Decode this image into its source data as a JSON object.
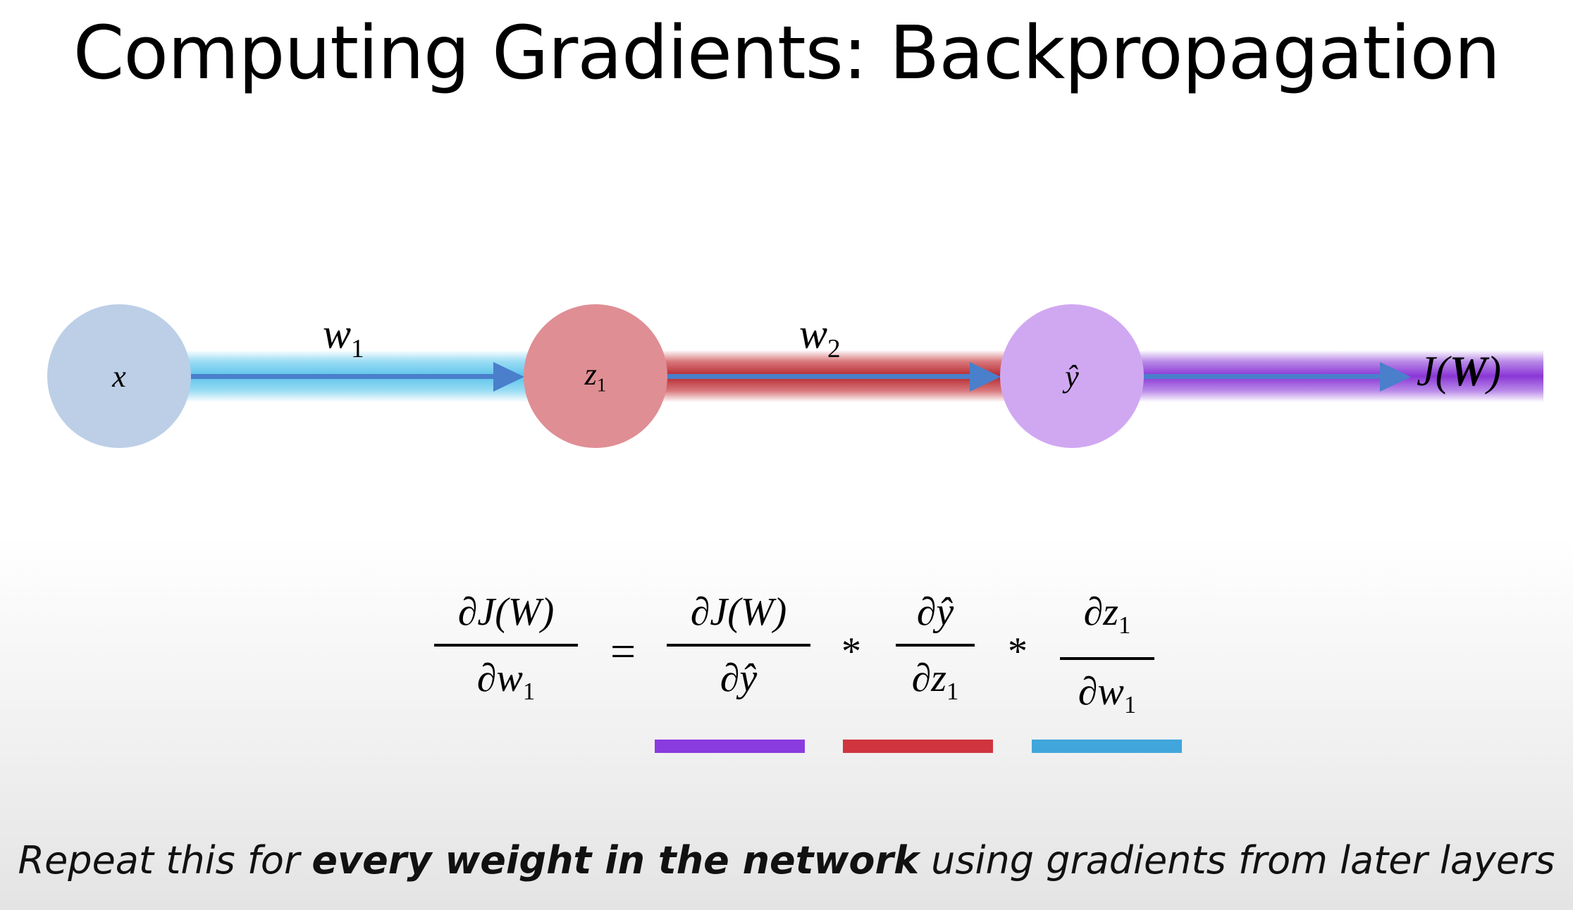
{
  "title": "Computing Gradients: Backpropagation",
  "diagram": {
    "nodes": [
      {
        "id": "x",
        "label": "x",
        "color": "#bccfe7"
      },
      {
        "id": "z1",
        "label": "z",
        "sub": "1",
        "color": "#df8e94"
      },
      {
        "id": "yhat",
        "label": "ŷ",
        "color": "#d0a8f2"
      }
    ],
    "edges": [
      {
        "label": "w",
        "sub": "1",
        "color": "#5cc4ea"
      },
      {
        "label": "w",
        "sub": "2",
        "color": "#b5262d"
      },
      {
        "color": "#8a36d6"
      }
    ],
    "output_label_pre": "J(",
    "output_label_bold": "W",
    "output_label_post": ")",
    "arrow_color": "#4a7fcb"
  },
  "equation": {
    "lhs": {
      "num": "∂J(W)",
      "den_pre": "∂w",
      "den_sub": "1"
    },
    "equals": "=",
    "times": "*",
    "terms": [
      {
        "num": "∂J(W)",
        "den": "∂ŷ",
        "underline_color": "#8a3be0"
      },
      {
        "num": "∂ŷ",
        "den_pre": "∂z",
        "den_sub": "1",
        "underline_color": "#d0343e"
      },
      {
        "num_pre": "∂z",
        "num_sub": "1",
        "den_pre": "∂w",
        "den_sub": "1",
        "underline_color": "#41a6dc"
      }
    ]
  },
  "footer": {
    "pre": "Repeat this for ",
    "bold": "every weight in the network",
    "post": " using gradients from later layers"
  }
}
